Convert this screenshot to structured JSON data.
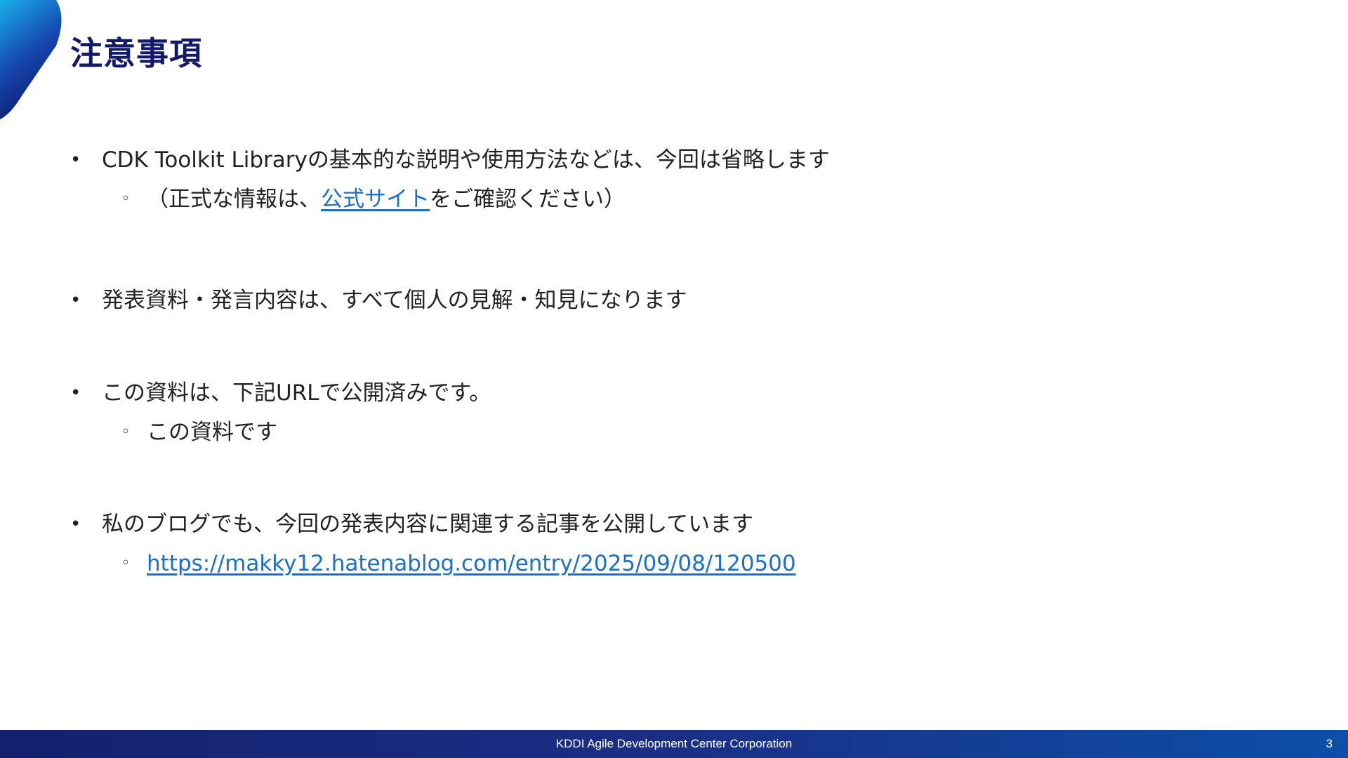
{
  "slide": {
    "title": "注意事項",
    "page_number": "3"
  },
  "items": [
    {
      "text": "CDK Toolkit Libraryの基本的な説明や使用方法などは、今回は省略します",
      "sub": {
        "prefix": "（正式な情報は、",
        "link_text": "公式サイト",
        "suffix": "をご確認ください）"
      }
    },
    {
      "text": "発表資料・発言内容は、すべて個人の見解・知見になります"
    },
    {
      "text": "この資料は、下記URLで公開済みです。",
      "sub": {
        "text": "この資料です"
      }
    },
    {
      "text": "私のブログでも、今回の発表内容に関連する記事を公開しています",
      "sub": {
        "link_text": "https://makky12.hatenablog.com/entry/2025/09/08/120500"
      }
    }
  ],
  "bullets": {
    "level1": "•",
    "level2": "◦"
  },
  "footer": {
    "text": "KDDI Agile Development Center Corporation"
  },
  "colors": {
    "title": "#13196b",
    "link": "#1c6fc9",
    "footer_start": "#14206e",
    "footer_end": "#0c4fa8",
    "accent_light": "#1ab0ea",
    "accent_dark": "#0e1a6c"
  }
}
